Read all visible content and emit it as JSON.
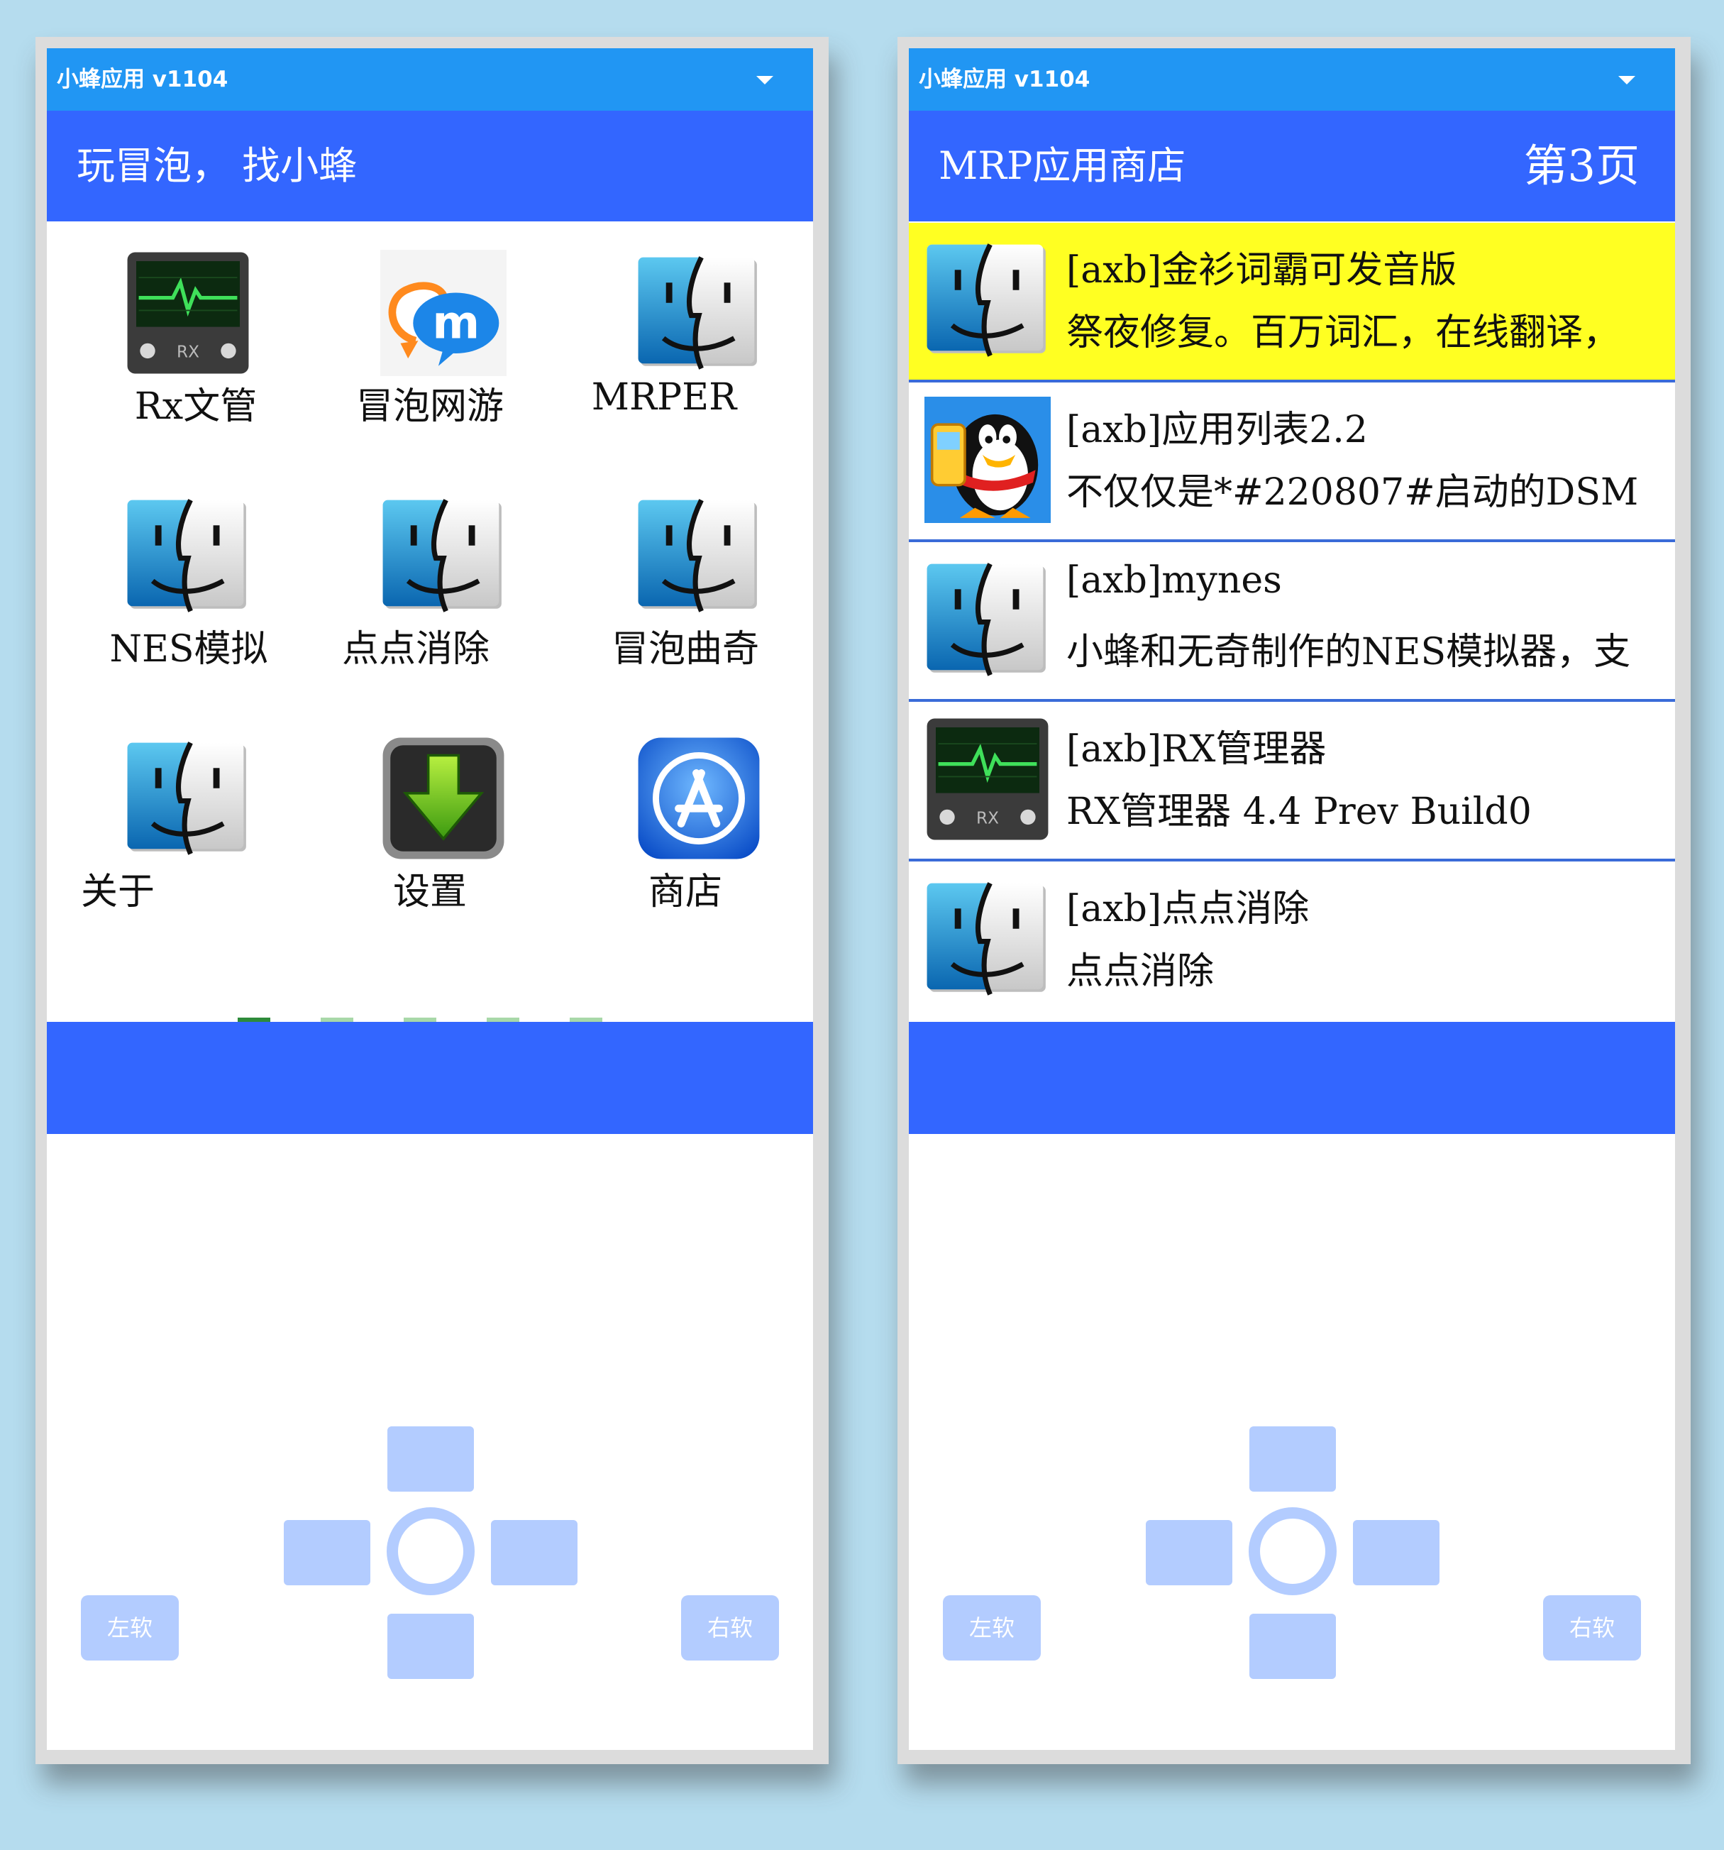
{
  "left": {
    "titlebar": {
      "title": "小蜂应用 v1104"
    },
    "header": {
      "title": "玩冒泡， 找小蜂"
    },
    "apps": [
      {
        "label": "Rx文管",
        "icon": "rx-monitor-icon"
      },
      {
        "label": "冒泡网游",
        "icon": "mopo-chat-icon"
      },
      {
        "label": "MRPER",
        "icon": "finder-face-icon"
      },
      {
        "label": "NES模拟",
        "icon": "finder-face-icon"
      },
      {
        "label": "点点消除",
        "icon": "finder-face-icon"
      },
      {
        "label": "冒泡曲奇",
        "icon": "finder-face-icon"
      },
      {
        "label": "关于",
        "icon": "finder-face-icon"
      },
      {
        "label": "设置",
        "icon": "download-arrow-icon"
      },
      {
        "label": "商店",
        "icon": "app-store-icon"
      }
    ],
    "page_indicator": {
      "pages": 5,
      "active": 1
    },
    "controls": {
      "left_soft": "左软",
      "right_soft": "右软"
    }
  },
  "right": {
    "titlebar": {
      "title": "小蜂应用 v1104"
    },
    "header": {
      "title": "MRP应用商店",
      "page": "第3页"
    },
    "items": [
      {
        "title": "[axb]金衫词霸可发音版",
        "desc": "祭夜修复。百万词汇，在线翻译，",
        "icon": "finder-face-icon",
        "selected": true
      },
      {
        "title": "[axb]应用列表2.2",
        "desc": "不仅仅是*#220807#启动的DSM",
        "icon": "qq-penguin-icon",
        "selected": false
      },
      {
        "title": "[axb]mynes",
        "desc": "小蜂和无奇制作的NES模拟器，支",
        "icon": "finder-face-icon",
        "selected": false
      },
      {
        "title": "[axb]RX管理器",
        "desc": "RX管理器 4.4 Prev Build0",
        "icon": "rx-monitor-icon",
        "selected": false
      },
      {
        "title": "[axb]点点消除",
        "desc": "点点消除",
        "icon": "finder-face-icon",
        "selected": false
      }
    ],
    "controls": {
      "left_soft": "左软",
      "right_soft": "右软"
    }
  },
  "colors": {
    "titlebar": "#2196f3",
    "header": "#3366ff",
    "selected_row": "#ffff22",
    "control": "#b3ccff",
    "page_active": "#2e8b3a",
    "page_inactive": "#a8d8a8"
  }
}
